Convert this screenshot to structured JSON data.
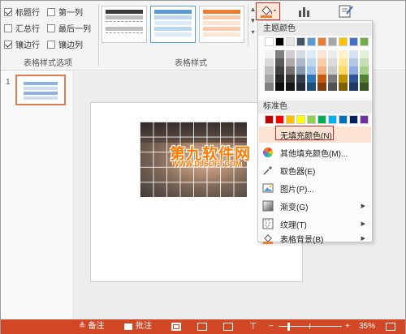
{
  "ribbon": {
    "table_style_options": {
      "group_label": "表格样式选项",
      "options": [
        {
          "label": "标题行",
          "checked": true
        },
        {
          "label": "第一列",
          "checked": false
        },
        {
          "label": "汇总行",
          "checked": false
        },
        {
          "label": "最后一列",
          "checked": false
        },
        {
          "label": "镶边行",
          "checked": true
        },
        {
          "label": "镶边列",
          "checked": false
        }
      ]
    },
    "table_styles": {
      "group_label": "表格样式",
      "thumbnails": [
        {
          "name": "dark",
          "header": "#3c3c3c",
          "band": "#bfbfbf"
        },
        {
          "name": "blue",
          "header": "#5b9bd5",
          "band": "#bdd7ee"
        },
        {
          "name": "orange",
          "header": "#ed7d31",
          "band": "#f8cbad"
        }
      ]
    },
    "shading_button_icon": "paint-bucket-icon",
    "accent_red": "#c62828"
  },
  "slides": [
    {
      "number": "1"
    }
  ],
  "watermark": {
    "title": "第九软件网",
    "url": "WWW.D9SOFT.COM"
  },
  "dropdown": {
    "theme_colors_label": "主题颜色",
    "standard_colors_label": "标准色",
    "theme_colors": [
      "#ffffff",
      "#000000",
      "#e7e6e6",
      "#44546a",
      "#5b9bd5",
      "#ed7d31",
      "#a5a5a5",
      "#ffc000",
      "#4472c4",
      "#70ad47"
    ],
    "theme_shades": [
      [
        "#f2f2f2",
        "#d9d9d9",
        "#bfbfbf",
        "#a6a6a6",
        "#808080"
      ],
      [
        "#7f7f7f",
        "#595959",
        "#404040",
        "#262626",
        "#0d0d0d"
      ],
      [
        "#d0cece",
        "#aeaaaa",
        "#757171",
        "#3a3838",
        "#171616"
      ],
      [
        "#d6dce4",
        "#adb9ca",
        "#8497b0",
        "#333f4f",
        "#222a35"
      ],
      [
        "#deebf6",
        "#bdd7ee",
        "#9dc3e6",
        "#2e75b5",
        "#1f4e79"
      ],
      [
        "#fbe5d5",
        "#f8cbad",
        "#f4b183",
        "#c55a11",
        "#833c0b"
      ],
      [
        "#ededed",
        "#dbdbdb",
        "#c9c9c9",
        "#7b7b7b",
        "#525252"
      ],
      [
        "#fff2cc",
        "#ffe699",
        "#ffd966",
        "#bf9000",
        "#7f6000"
      ],
      [
        "#dae3f3",
        "#b4c7e7",
        "#8faadc",
        "#2f5597",
        "#203864"
      ],
      [
        "#e2efd9",
        "#c5e0b3",
        "#a8d08d",
        "#538135",
        "#375623"
      ]
    ],
    "standard_colors": [
      "#c00000",
      "#ff0000",
      "#ffc000",
      "#ffff00",
      "#92d050",
      "#00b050",
      "#00b0f0",
      "#0070c0",
      "#002060",
      "#7030a0"
    ],
    "items": [
      {
        "label": "无填充颜色(N)",
        "icon": "no-fill-icon",
        "has_arrow": false,
        "highlighted": true
      },
      {
        "label": "其他填充颜色(M)...",
        "icon": "color-wheel-icon",
        "has_arrow": false,
        "highlighted": false
      },
      {
        "label": "取色器(E)",
        "icon": "eyedropper-icon",
        "has_arrow": false,
        "highlighted": false
      },
      {
        "label": "图片(P)...",
        "icon": "picture-icon",
        "has_arrow": false,
        "highlighted": false
      },
      {
        "label": "渐变(G)",
        "icon": "gradient-icon",
        "has_arrow": true,
        "highlighted": false
      },
      {
        "label": "纹理(T)",
        "icon": "texture-icon",
        "has_arrow": true,
        "highlighted": false
      },
      {
        "label": "表格背景(B)",
        "icon": "table-background-icon",
        "has_arrow": true,
        "highlighted": false
      }
    ]
  },
  "statusbar": {
    "notes_label": "备注",
    "comments_label": "批注",
    "zoom_minus": "−",
    "zoom_plus": "+",
    "zoom_percent": "35%",
    "zoom_level": 0.35,
    "background": "#d24726"
  }
}
